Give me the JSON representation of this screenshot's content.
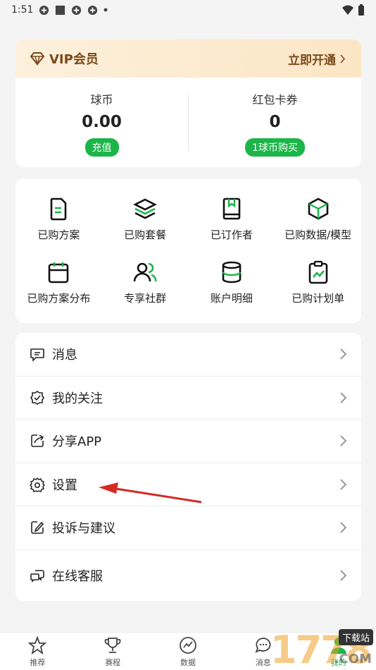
{
  "status": {
    "time": "1:51"
  },
  "vip": {
    "title": "VIP会员",
    "open_label": "立即开通"
  },
  "wallet": {
    "coins_label": "球币",
    "coins_value": "0.00",
    "recharge_label": "充值",
    "coupons_label": "红包卡券",
    "coupons_value": "0",
    "buy_label": "1球币购买"
  },
  "grid": [
    {
      "label": "已购方案",
      "icon": "document-icon"
    },
    {
      "label": "已购套餐",
      "icon": "layers-icon"
    },
    {
      "label": "已订作者",
      "icon": "bookmark-book-icon"
    },
    {
      "label": "已购数据/模型",
      "icon": "cube-icon"
    },
    {
      "label": "已购方案分布",
      "icon": "calendar-icon"
    },
    {
      "label": "专享社群",
      "icon": "users-icon"
    },
    {
      "label": "账户明细",
      "icon": "database-icon"
    },
    {
      "label": "已购计划单",
      "icon": "clipboard-chart-icon"
    }
  ],
  "menu": [
    {
      "label": "消息",
      "icon": "message-icon"
    },
    {
      "label": "我的关注",
      "icon": "check-badge-icon"
    },
    {
      "label": "分享APP",
      "icon": "share-icon"
    },
    {
      "label": "设置",
      "icon": "gear-icon"
    },
    {
      "label": "投诉与建议",
      "icon": "edit-icon"
    },
    {
      "label": "在线客服",
      "icon": "chat-icon"
    }
  ],
  "tabs": [
    {
      "label": "推荐",
      "icon": "star-icon"
    },
    {
      "label": "赛程",
      "icon": "trophy-icon"
    },
    {
      "label": "数据",
      "icon": "chart-circle-icon"
    },
    {
      "label": "消息",
      "icon": "chat-bubble-icon"
    },
    {
      "label": "我的",
      "icon": "person-icon"
    }
  ],
  "watermark": {
    "text": "1778",
    "badge": "下载站",
    "domain": ".COM"
  },
  "colors": {
    "accent": "#1cb549",
    "vip_text": "#7a4a1d",
    "arrow": "#d42a22"
  }
}
